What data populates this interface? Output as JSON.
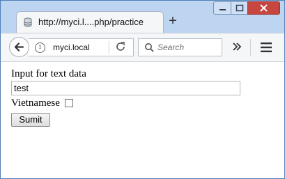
{
  "tab": {
    "title": "http://myci.l....php/practice"
  },
  "navbar": {
    "url": "myci.local",
    "search_placeholder": "Search"
  },
  "form": {
    "input_label": "Input for text data",
    "input_value": "test",
    "checkbox_label": "Vietnamese",
    "checkbox_checked": false,
    "submit_label": "Sumit"
  },
  "icons": {
    "tab_favicon": "page-icon",
    "new_tab": "plus-icon",
    "back": "back-arrow-icon",
    "info": "info-icon",
    "reload": "reload-icon",
    "search": "search-icon",
    "overflow": "double-chevron-icon",
    "menu": "hamburger-icon"
  }
}
